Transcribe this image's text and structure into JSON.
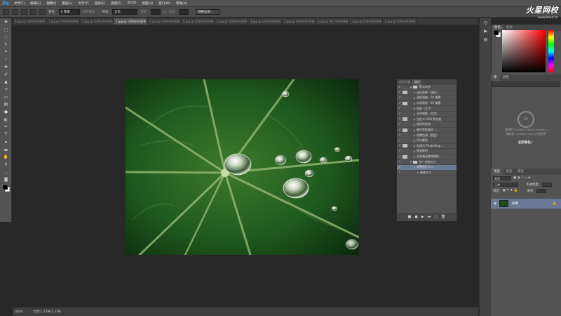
{
  "app": {
    "logo": "Ps"
  },
  "menu": [
    "文件(F)",
    "编辑(E)",
    "图像(I)",
    "图层(L)",
    "文字(Y)",
    "选择(S)",
    "滤镜(T)",
    "3D(D)",
    "视图(V)",
    "窗口(W)",
    "帮助(H)"
  ],
  "brand": {
    "name": "火星网校",
    "url": "www.hxsd.cn"
  },
  "options_bar": {
    "feather_label": "羽化:",
    "feather_value": "0 像素",
    "antialias_label": "消除锯齿",
    "style_label": "样式:",
    "style_value": "正常",
    "width_label": "宽度:",
    "height_label": "高度:",
    "refine_button": "调整边缘..."
  },
  "doc_tabs": [
    "9.jpg @ 100%(RGB/8)",
    "7.jpg @ 100%(RGB/8)",
    "5.jpg @ 100%(RGB/8)",
    "7.jpg @ 100%(RGB/8)",
    "5.jpg @ 100%(RGB/8)",
    "5.jpg @ 100%(RGB/8)",
    "6.jpg @ 100%(RGB/8)",
    "4.jpg @ 100%(RGB/8)",
    "2.jpg @ 100%(RGB/8)",
    "3.jpg @ 66.7%(RGB/8)",
    "1.jpg @ 100%(RGB/8)",
    "8.jpg @ 100%(RGB/8)"
  ],
  "active_tab_index": 3,
  "actions_panel": {
    "tabs": [
      "历史记录",
      "动作"
    ],
    "rows": [
      {
        "label": "默认动作",
        "type": "folder",
        "dialog": false
      },
      {
        "label": "淡出效果（选区）",
        "type": "action",
        "dialog": true
      },
      {
        "label": "画框通道 - 50 像素",
        "type": "action",
        "dialog": false
      },
      {
        "label": "木质画框 - 50 像素",
        "type": "action",
        "dialog": true
      },
      {
        "label": "投影（文字）",
        "type": "action",
        "dialog": false
      },
      {
        "label": "水中倒影（文字）",
        "type": "action",
        "dialog": false
      },
      {
        "label": "自定义 RGB 到灰度",
        "type": "action",
        "dialog": true
      },
      {
        "label": "熔化的铅块",
        "type": "action",
        "dialog": false
      },
      {
        "label": "制作剪贴路径（...",
        "type": "action",
        "dialog": true
      },
      {
        "label": "棕褐色调（图层）",
        "type": "action",
        "dialog": false
      },
      {
        "label": "四分颜色",
        "type": "action",
        "dialog": false
      },
      {
        "label": "存储为 Photoshop ...",
        "type": "action",
        "dialog": true
      },
      {
        "label": "渐变映射",
        "type": "action",
        "dialog": false
      },
      {
        "label": "混合器画笔克隆绘...",
        "type": "action",
        "dialog": true
      },
      {
        "label": "统一控制大小",
        "type": "folder",
        "dialog": false
      },
      {
        "label": "调整图片大小",
        "type": "action",
        "dialog": false,
        "selected": true
      },
      {
        "label": "图像大小",
        "type": "step",
        "dialog": false
      }
    ],
    "footer_icons": [
      "stop-icon",
      "record-icon",
      "play-icon",
      "new-set-icon",
      "new-action-icon",
      "delete-icon"
    ]
  },
  "color_panel": {
    "tabs": [
      "颜色",
      "色板"
    ]
  },
  "library_panel": {
    "tabs": [
      "库",
      "调整"
    ],
    "text_1": "要使用 Creative Cloud Libraries,",
    "text_2": "请安装 Creative Cloud 应用程序",
    "link": "立即联机！"
  },
  "layers_panel": {
    "tabs": [
      "图层",
      "通道",
      "路径"
    ],
    "kind_label": "类型",
    "blend_mode": "正常",
    "opacity_label": "不透明度:",
    "lock_label": "锁定:",
    "fill_label": "填充:",
    "layer_name": "背景"
  },
  "status_bar": {
    "zoom": "100%",
    "doc_info": "文档:1.37M/1.37M"
  },
  "colors": {
    "accent_selection": "#6b7a94",
    "ps_blue": "#31a8ff"
  }
}
